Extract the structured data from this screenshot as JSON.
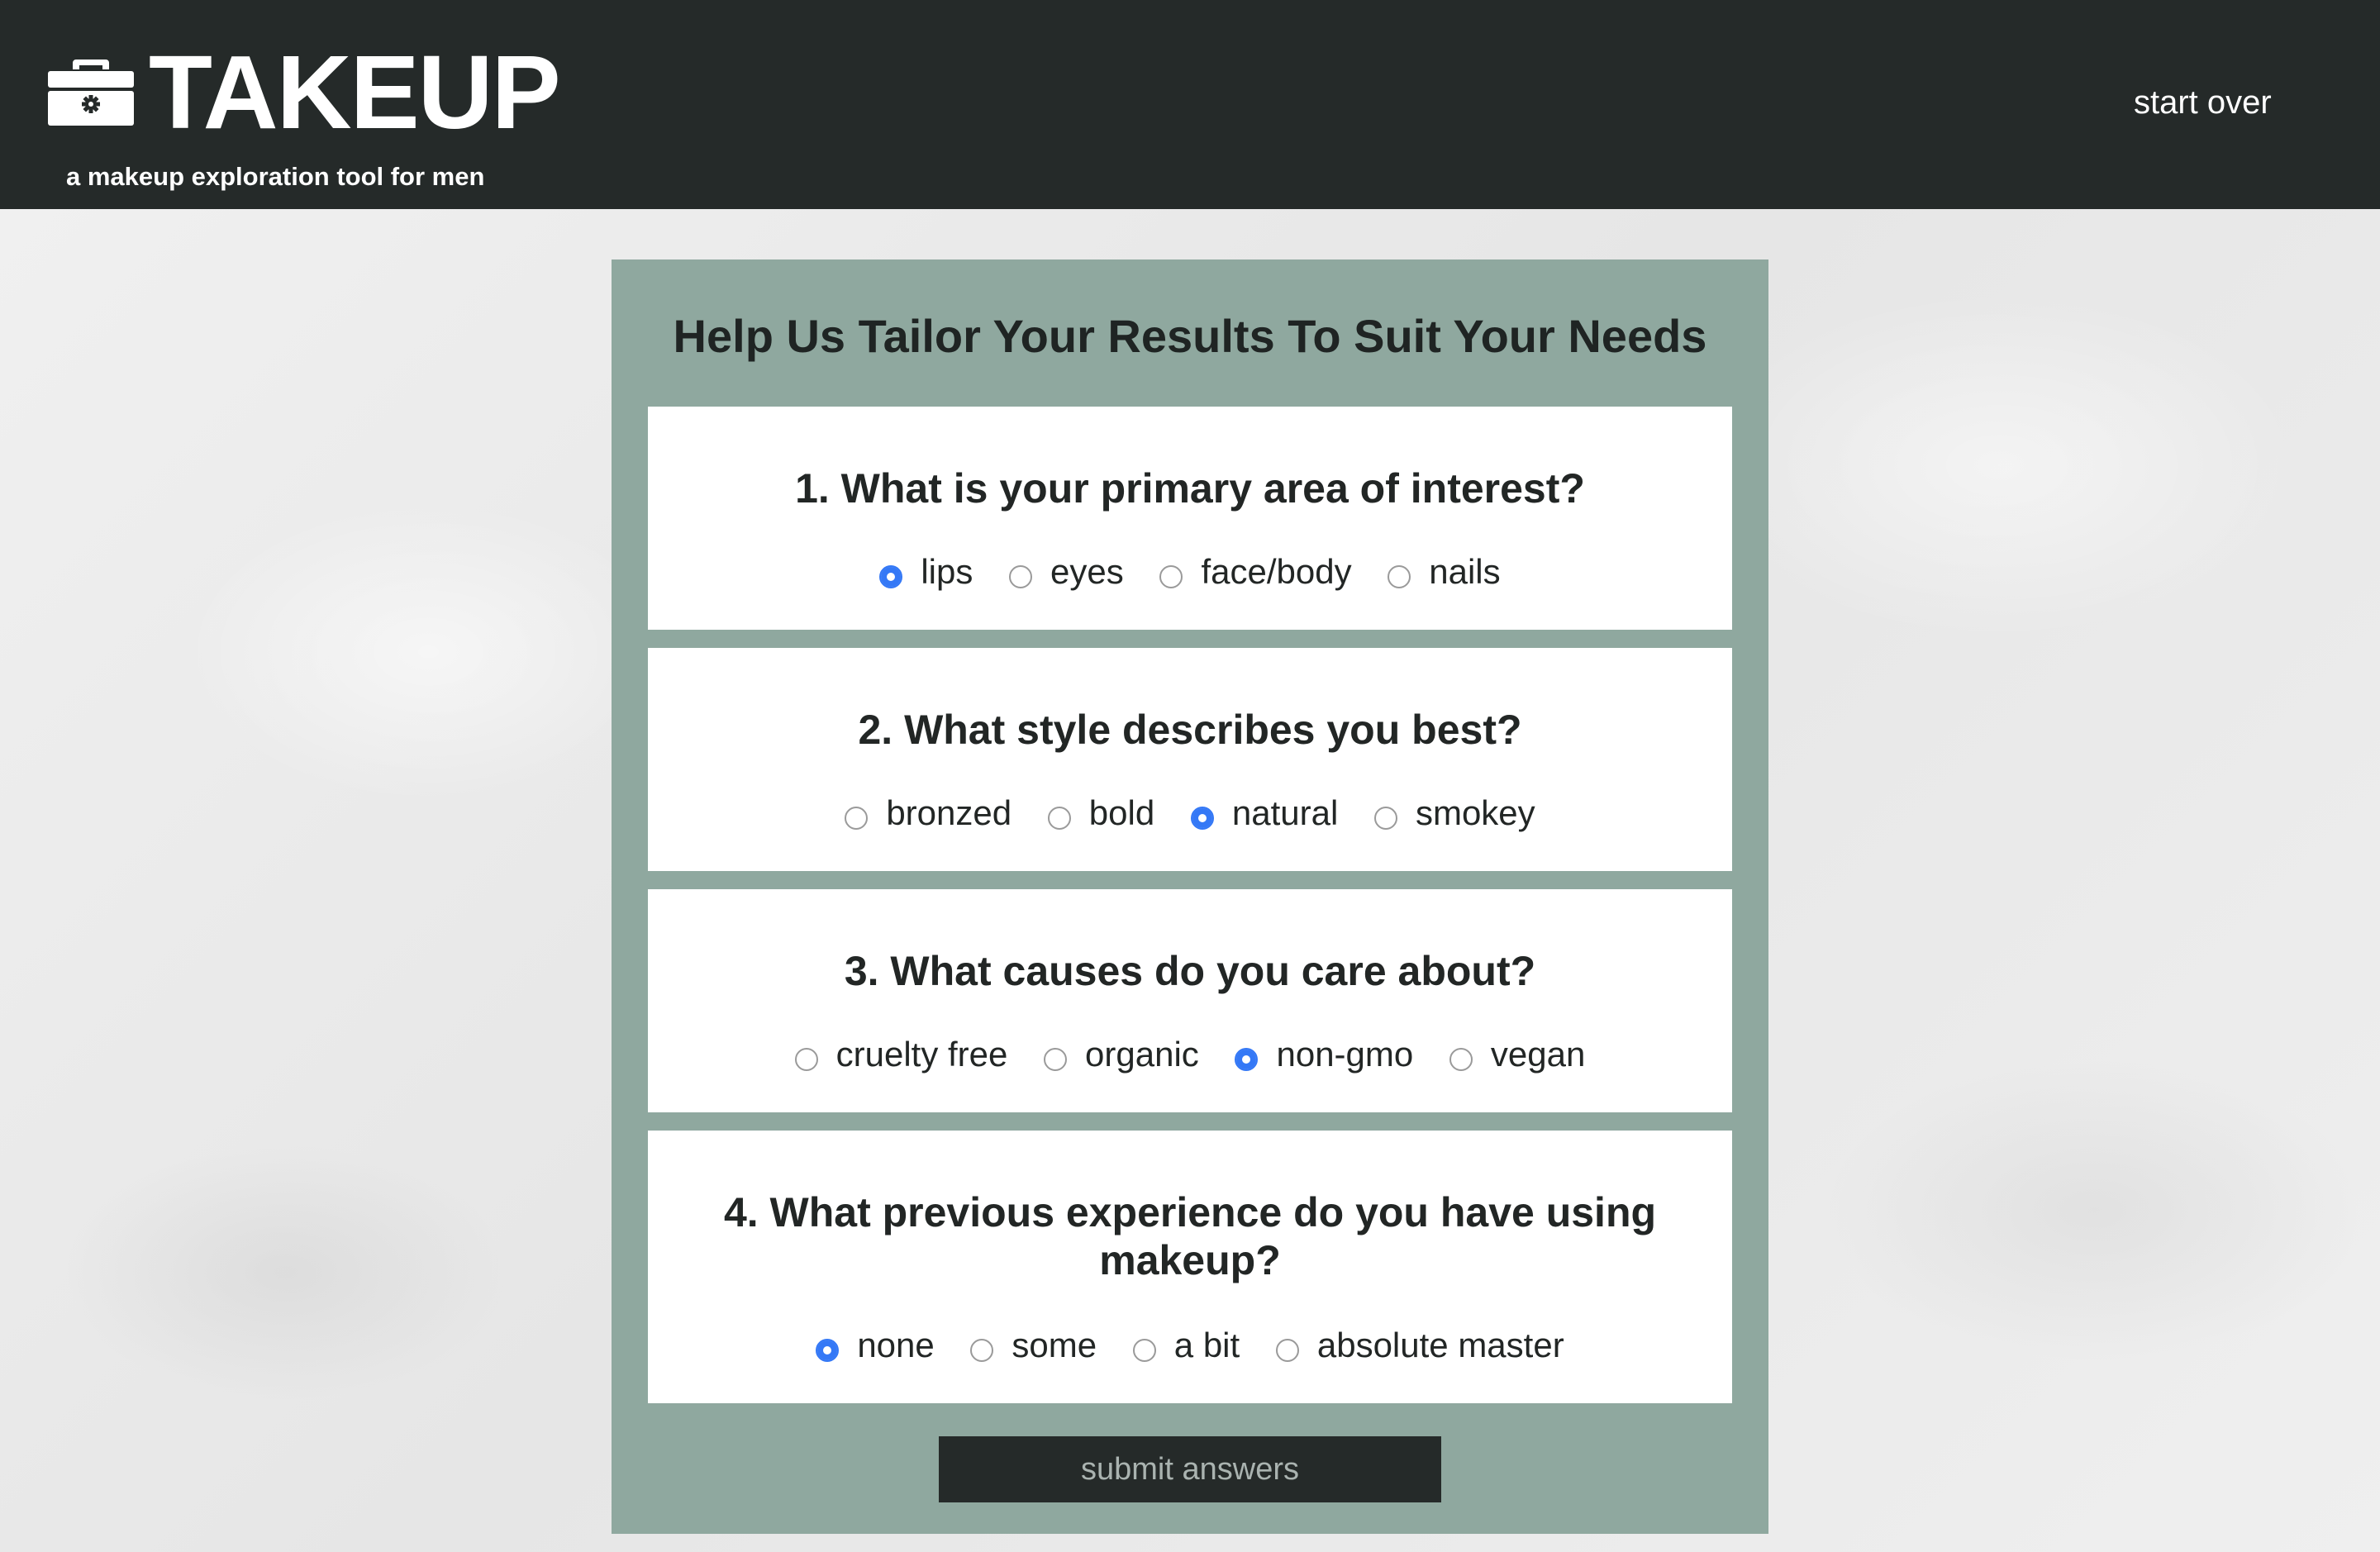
{
  "header": {
    "brand": "TAKEUP",
    "tagline": "a makeup exploration tool for men",
    "logo_icon": "toolbox-gear-icon",
    "start_over_label": "start over",
    "background_color": "#252a29"
  },
  "form": {
    "title": "Help Us Tailor Your Results To Suit Your Needs",
    "panel_color": "#8fa89f",
    "accent_color": "#3478f6",
    "questions": [
      {
        "text": "1. What is your primary area of interest?",
        "options": [
          "lips",
          "eyes",
          "face/body",
          "nails"
        ],
        "selected": "lips"
      },
      {
        "text": "2. What style describes you best?",
        "options": [
          "bronzed",
          "bold",
          "natural",
          "smokey"
        ],
        "selected": "natural"
      },
      {
        "text": "3. What causes do you care about?",
        "options": [
          "cruelty free",
          "organic",
          "non-gmo",
          "vegan"
        ],
        "selected": "non-gmo"
      },
      {
        "text": "4. What previous experience do you have using makeup?",
        "options": [
          "none",
          "some",
          "a bit",
          "absolute master"
        ],
        "selected": "none"
      }
    ],
    "submit_label": "submit answers"
  }
}
